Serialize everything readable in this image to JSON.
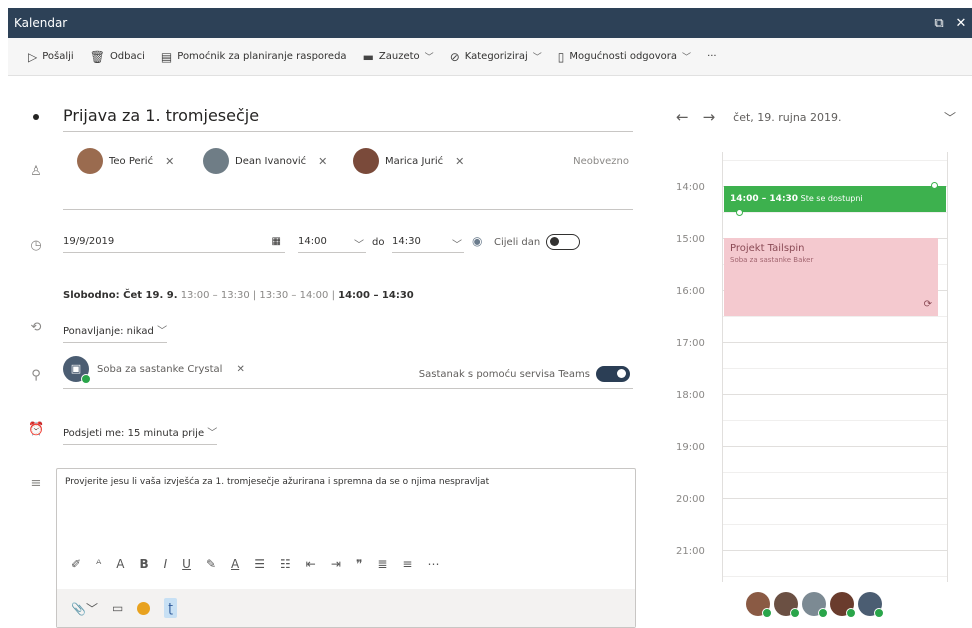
{
  "window": {
    "title": "Kalendar",
    "popout_glyph": "⧉",
    "close_glyph": "✕"
  },
  "toolbar": {
    "send": "Pošalji",
    "discard": "Odbaci",
    "scheduling": "Pomoćnik za planiranje rasporeda",
    "busy": "Zauzeto",
    "categorize": "Kategoriziraj",
    "response_options": "Mogućnosti odgovora",
    "more": "···"
  },
  "event": {
    "title": "Prijava za 1. tromjesečje",
    "attendees": [
      {
        "name": "Teo Perić",
        "color": "#9a6b4f"
      },
      {
        "name": "Dean Ivanović",
        "color": "#6f7d86"
      },
      {
        "name": "Marica Jurić",
        "color": "#7a4a3a"
      }
    ],
    "optional_label": "Neobvezno",
    "date": "19/9/2019",
    "start_time": "14:00",
    "to_label": "do",
    "end_time": "14:30",
    "all_day_label": "Cijeli dan",
    "free_label": "Slobodno: Čet 19. 9.",
    "free_slots_muted": "13:00 – 13:30 | 13:30 – 14:00 |",
    "free_slot_selected": "14:00 – 14:30",
    "recurrence": "Ponavljanje: nikad",
    "room": "Soba za sastanke Crystal",
    "teams_label": "Sastanak s pomoću servisa Teams",
    "reminder": "Podsjeti me: 15 minuta prije",
    "body": "Provjerite jesu li vaša izvješća za 1. tromjesečje ažurirana i spremna da se o njima nespravljat"
  },
  "calendar": {
    "date_label": "čet, 19. rujna 2019.",
    "hours": [
      "14:00",
      "15:00",
      "16:00",
      "17:00",
      "18:00",
      "19:00",
      "20:00",
      "21:00"
    ],
    "green_event": {
      "time": "14:00 – 14:30",
      "note": "Ste se dostupni",
      "color": "#3db14e"
    },
    "pink_event": {
      "title": "Projekt Tailspin",
      "subtitle": "Soba za sastanke Baker",
      "color": "#f4c9cf"
    },
    "people_colors": [
      "#8a5a44",
      "#6b5043",
      "#7c8a93",
      "#6a3c2d",
      "#4b5d72"
    ]
  }
}
